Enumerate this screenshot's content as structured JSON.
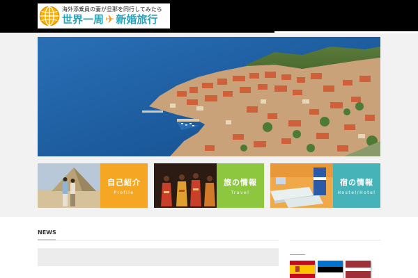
{
  "header": {
    "logo_subtitle": "海外添乗員の妻が旦那を同行してみたら",
    "logo_title_left": "世界一周",
    "logo_title_right": "新婚旅行"
  },
  "cards": [
    {
      "title": "自己紹介",
      "subtitle": "Profile",
      "color": "#f5a623"
    },
    {
      "title": "旅の情報",
      "subtitle": "Travel",
      "color": "#8dc63f"
    },
    {
      "title": "宿の情報",
      "subtitle": "Hostel/Hotel",
      "color": "#46b3b8"
    }
  ],
  "news": {
    "heading": "NEWS"
  },
  "flags": [
    "spain-flag",
    "estonia-flag",
    "latvia-flag"
  ]
}
